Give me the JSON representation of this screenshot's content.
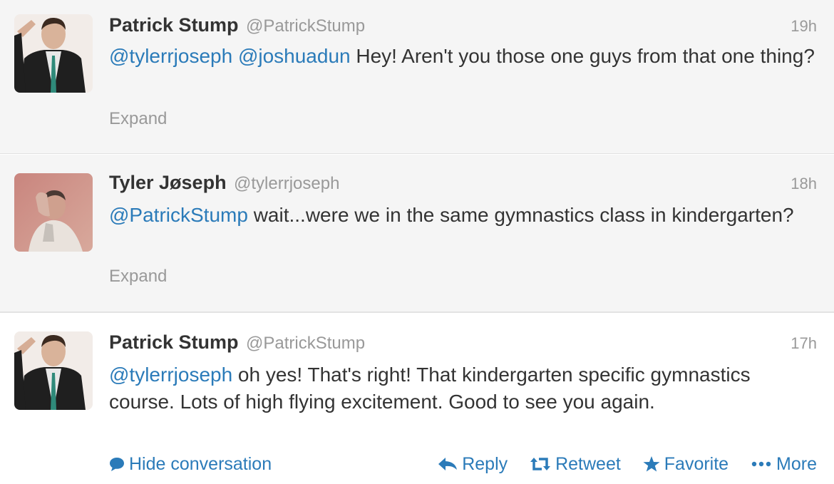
{
  "tweets": [
    {
      "fullname": "Patrick Stump",
      "username": "@PatrickStump",
      "time": "19h",
      "mention1": "@tylerrjoseph",
      "mention2": "@joshuadun",
      "text": " Hey! Aren't you those one guys from that one thing?",
      "expand": "Expand"
    },
    {
      "fullname": "Tyler Jøseph",
      "username": "@tylerrjoseph",
      "time": "18h",
      "mention1": "@PatrickStump",
      "text": " wait...were we in the same gymnastics class in kindergarten?",
      "expand": "Expand"
    },
    {
      "fullname": "Patrick Stump",
      "username": "@PatrickStump",
      "time": "17h",
      "mention1": "@tylerrjoseph",
      "text": " oh yes! That's right! That kindergarten specific gymnastics course. Lots of high flying excitement. Good to see you again."
    }
  ],
  "actions": {
    "hide_conversation": "Hide conversation",
    "reply": "Reply",
    "retweet": "Retweet",
    "favorite": "Favorite",
    "more": "More"
  },
  "icons": {
    "hide": "speech-bubble-icon",
    "reply": "reply-arrow-icon",
    "retweet": "retweet-icon",
    "favorite": "star-icon",
    "more": "ellipsis-icon"
  },
  "colors": {
    "link": "#2b7bb9",
    "meta": "#999999",
    "text": "#333333"
  }
}
